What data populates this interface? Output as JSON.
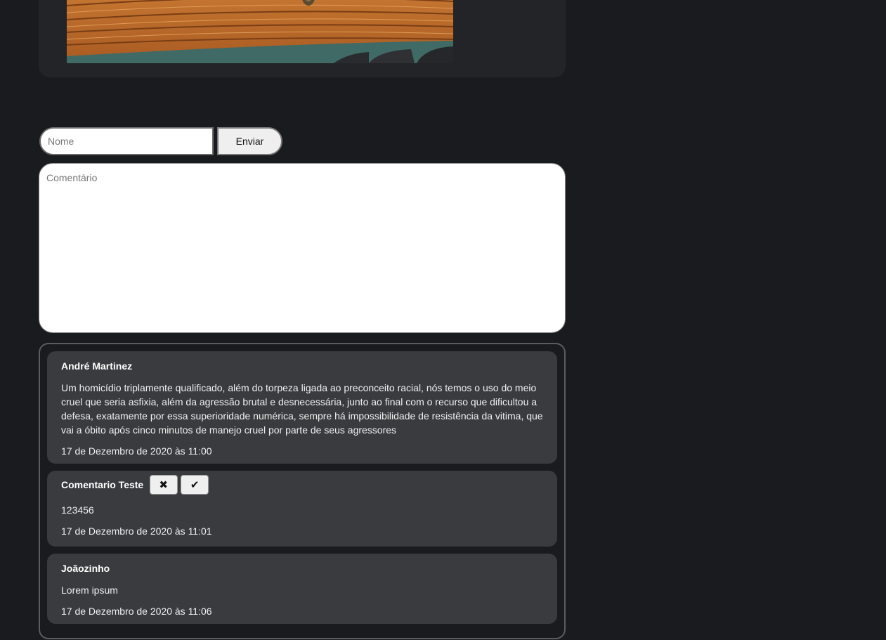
{
  "form": {
    "name_placeholder": "Nome",
    "send_label": "Enviar",
    "comment_placeholder": "Comentário"
  },
  "comments": [
    {
      "author": "André Martinez",
      "text": "Um homicídio triplamente qualificado, além do torpeza ligada ao preconceito racial, nós temos o uso do meio cruel que seria asfixia, além da agressão brutal e desnecessária, junto ao final com o recurso que dificultou a defesa, exatamente por essa superioridade numérica, sempre há impossibilidade de resistência da vitima, que vai a óbito após cinco minutos de manejo cruel por parte de seus agressores",
      "date": "17 de Dezembro de 2020 às 11:00"
    },
    {
      "author": "Comentario Teste",
      "text": "123456",
      "date": "17 de Dezembro de 2020 às 11:01",
      "reject_icon": "close-icon",
      "approve_icon": "check-icon"
    },
    {
      "author": "Joãozinho",
      "text": "Lorem ipsum",
      "date": "17 de Dezembro de 2020 às 11:06"
    }
  ]
}
